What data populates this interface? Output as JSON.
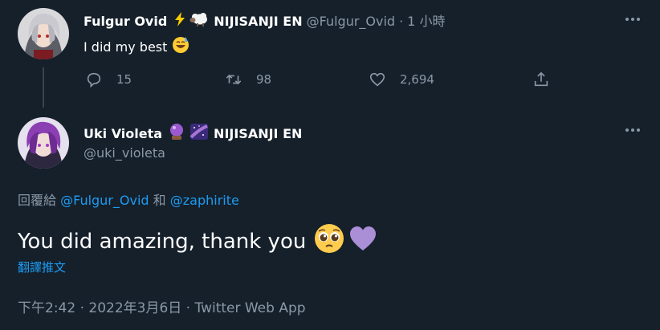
{
  "tweet1": {
    "display_name": "Fulgur Ovid",
    "org": "NIJISANJI EN",
    "handle": "@Fulgur_Ovid",
    "sep": "·",
    "time": "1 小時",
    "text": "I did my best",
    "actions": {
      "replies": "15",
      "retweets": "98",
      "likes": "2,694"
    }
  },
  "tweet2": {
    "display_name": "Uki Violeta",
    "org": "NIJISANJI EN",
    "handle": "@uki_violeta",
    "reply_prefix": "回覆給",
    "reply_to_1": "@Fulgur_Ovid",
    "reply_and": "和",
    "reply_to_2": "@zaphirite",
    "text": "You did amazing, thank you",
    "translate": "翻譯推文",
    "meta": "下午2:42 · 2022年3月6日 · Twitter Web App"
  },
  "colors": {
    "background": "#15202b",
    "accent": "#1d9bf0",
    "muted": "#8b98a5",
    "divider": "#38444d"
  },
  "icons": {
    "t1_emoji_1": "lightning-emoji",
    "t1_emoji_2": "sheep-emoji",
    "t1_text_emoji": "sweat-smile-emoji",
    "t2_emoji_1": "crystal-ball-emoji",
    "t2_emoji_2": "milky-way-emoji",
    "t2_text_emoji_1": "pleading-face-emoji",
    "t2_text_emoji_2": "purple-heart-emoji"
  }
}
